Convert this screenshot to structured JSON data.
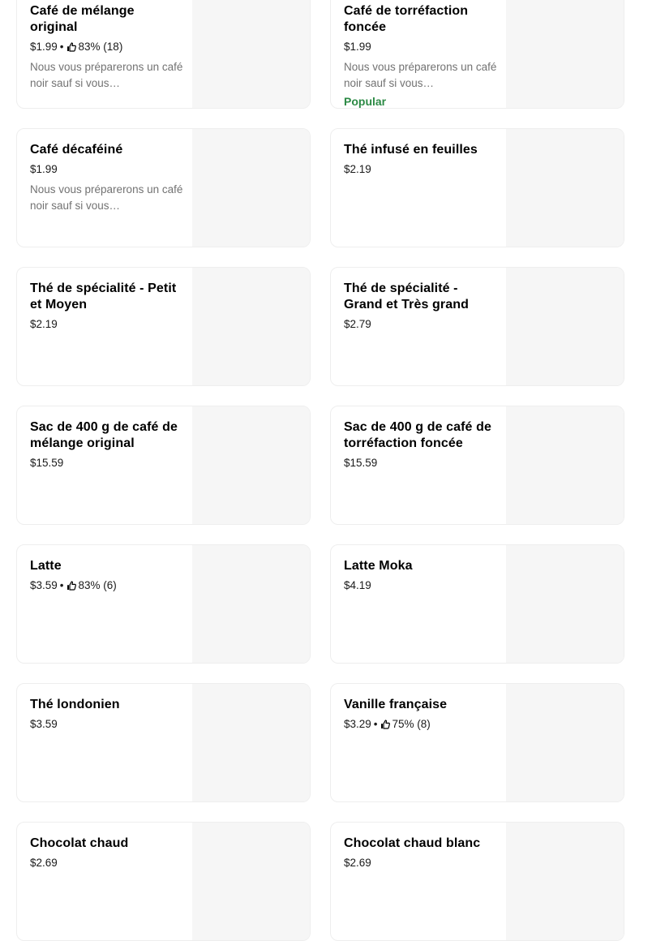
{
  "items": [
    {
      "name": "Café de mélange original",
      "price": "$1.99",
      "rating": "83% (18)",
      "description": "Nous vous préparerons un café noir sauf si vous…",
      "badge": ""
    },
    {
      "name": "Café de torréfaction foncée",
      "price": "$1.99",
      "rating": "",
      "description": "Nous vous préparerons un café noir sauf si vous…",
      "badge": "Popular"
    },
    {
      "name": "Café décaféiné",
      "price": "$1.99",
      "rating": "",
      "description": "Nous vous préparerons un café noir sauf si vous…",
      "badge": ""
    },
    {
      "name": "Thé infusé en feuilles",
      "price": "$2.19",
      "rating": "",
      "description": "",
      "badge": ""
    },
    {
      "name": "Thé de spécialité - Petit et Moyen",
      "price": "$2.19",
      "rating": "",
      "description": "",
      "badge": ""
    },
    {
      "name": "Thé de spécialité - Grand et Très grand",
      "price": "$2.79",
      "rating": "",
      "description": "",
      "badge": ""
    },
    {
      "name": "Sac de 400 g de café de mélange original",
      "price": "$15.59",
      "rating": "",
      "description": "",
      "badge": ""
    },
    {
      "name": "Sac de 400 g de café de torréfaction foncée",
      "price": "$15.59",
      "rating": "",
      "description": "",
      "badge": ""
    },
    {
      "name": "Latte",
      "price": "$3.59",
      "rating": "83% (6)",
      "description": "",
      "badge": ""
    },
    {
      "name": "Latte Moka",
      "price": "$4.19",
      "rating": "",
      "description": "",
      "badge": ""
    },
    {
      "name": "Thé londonien",
      "price": "$3.59",
      "rating": "",
      "description": "",
      "badge": ""
    },
    {
      "name": "Vanille française",
      "price": "$3.29",
      "rating": "75% (8)",
      "description": "",
      "badge": ""
    },
    {
      "name": "Chocolat chaud",
      "price": "$2.69",
      "rating": "",
      "description": "",
      "badge": ""
    },
    {
      "name": "Chocolat chaud blanc",
      "price": "$2.69",
      "rating": "",
      "description": "",
      "badge": ""
    }
  ],
  "separator": "•",
  "rating_icon": "thumbs-up-icon",
  "colors": {
    "badge": "#2c8a45",
    "description": "#727272",
    "image_placeholder": "#f6f6f6",
    "card_border": "#eeeeee"
  }
}
